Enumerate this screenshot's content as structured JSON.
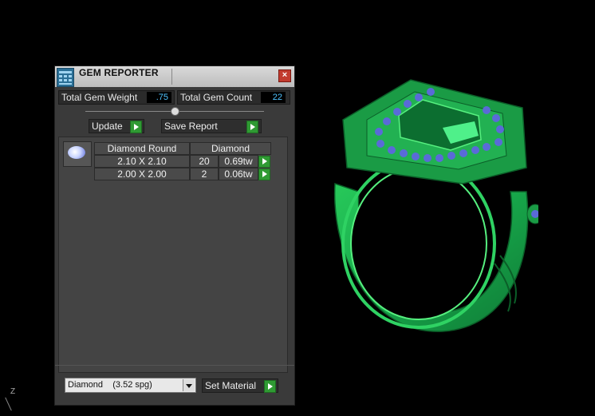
{
  "window": {
    "title": "GEM REPORTER",
    "close_glyph": "×"
  },
  "stats": {
    "weight_label": "Total Gem Weight",
    "weight_value": ".75",
    "count_label": "Total Gem Count",
    "count_value": "22"
  },
  "toolbar": {
    "update_label": "Update",
    "save_label": "Save Report"
  },
  "gem_table": {
    "headers": [
      "Diamond Round",
      "Diamond"
    ],
    "rows": [
      {
        "size": "2.10 X 2.10",
        "count": "20",
        "weight": "0.69tw"
      },
      {
        "size": "2.00 X 2.00",
        "count": "2",
        "weight": "0.06tw"
      }
    ]
  },
  "material": {
    "selected": "Diamond    (3.52 spg)",
    "set_label": "Set Material"
  },
  "viewport": {
    "axis_label": "Z"
  },
  "colors": {
    "accent_green": "#2f9a33",
    "value_blue": "#4fc3ff",
    "ring_green": "#1faa48",
    "gem_blue": "#5a6ad8"
  },
  "icons": [
    "gem-reporter-icon",
    "close-icon",
    "arrow-right-icon",
    "dropdown-arrow-icon",
    "gem-icon"
  ]
}
